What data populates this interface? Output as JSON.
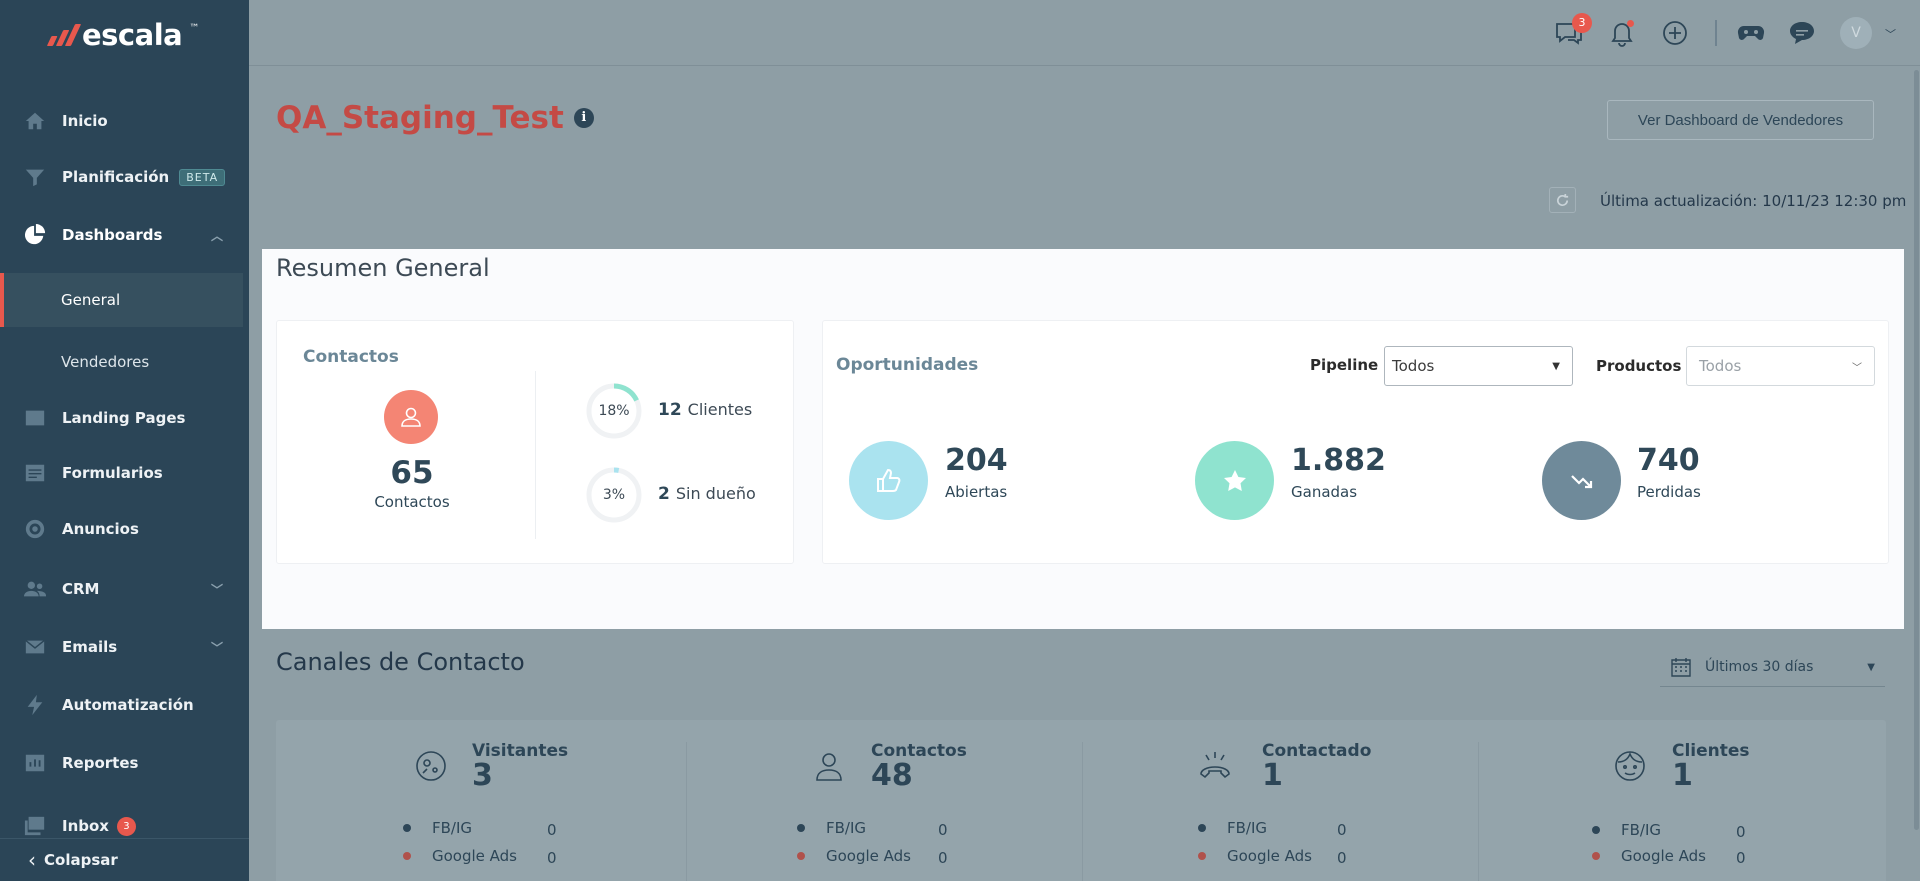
{
  "brand": {
    "name": "escala",
    "tm": "™"
  },
  "sidebar": {
    "items": [
      {
        "label": "Inicio",
        "icon": "home-icon"
      },
      {
        "label": "Planificación",
        "icon": "funnel-icon",
        "badge": "BETA"
      },
      {
        "label": "Dashboards",
        "icon": "pie-chart-icon"
      },
      {
        "label": "Landing Pages",
        "icon": "browser-icon"
      },
      {
        "label": "Formularios",
        "icon": "form-icon"
      },
      {
        "label": "Anuncios",
        "icon": "target-icon"
      },
      {
        "label": "CRM",
        "icon": "users-icon"
      },
      {
        "label": "Emails",
        "icon": "mail-icon"
      },
      {
        "label": "Automatización",
        "icon": "lightning-icon"
      },
      {
        "label": "Reportes",
        "icon": "report-icon"
      },
      {
        "label": "Inbox",
        "icon": "inbox-icon",
        "badge": "3"
      }
    ],
    "subitems": [
      {
        "label": "General"
      },
      {
        "label": "Vendedores"
      }
    ],
    "collapse_label": "Colapsar"
  },
  "topbar": {
    "chat_badge": "3",
    "avatar_initial": "V"
  },
  "page": {
    "title": "QA_Staging_Test",
    "info": "i",
    "sellers_button": "Ver Dashboard de Vendedores",
    "last_update": "Última actualización: 10/11/23 12:30 pm"
  },
  "summary": {
    "title": "Resumen General",
    "contacts": {
      "label": "Contactos",
      "total": "65",
      "total_label": "Contactos",
      "stats": [
        {
          "pct": "18%",
          "fraction": 0.18,
          "count": "12",
          "label": "Clientes"
        },
        {
          "pct": "3%",
          "fraction": 0.03,
          "count": "2",
          "label": "Sin dueño"
        }
      ]
    },
    "opportunities": {
      "label": "Oportunidades",
      "pipeline_label": "Pipeline",
      "pipeline_value": "Todos",
      "products_label": "Productos",
      "products_value": "Todos",
      "stats": [
        {
          "value": "204",
          "label": "Abiertas",
          "icon": "thumbs-up-icon",
          "color": "#aae3ef"
        },
        {
          "value": "1.882",
          "label": "Ganadas",
          "icon": "star-icon",
          "color": "#8fe3cf"
        },
        {
          "value": "740",
          "label": "Perdidas",
          "icon": "trend-down-icon",
          "color": "#6f8a9a"
        }
      ]
    }
  },
  "channels": {
    "title": "Canales de Contacto",
    "date_filter": "Últimos 30 días",
    "items": [
      {
        "title": "Visitantes",
        "count": "3",
        "icon": "visitor-icon",
        "rows": [
          {
            "label": "FB/IG",
            "value": "0",
            "color": "#2d4657"
          },
          {
            "label": "Google Ads",
            "value": "0",
            "color": "#b0514b"
          }
        ]
      },
      {
        "title": "Contactos",
        "count": "48",
        "icon": "person-icon",
        "rows": [
          {
            "label": "FB/IG",
            "value": "0",
            "color": "#2d4657"
          },
          {
            "label": "Google Ads",
            "value": "0",
            "color": "#b0514b"
          }
        ]
      },
      {
        "title": "Contactado",
        "count": "1",
        "icon": "phone-icon",
        "rows": [
          {
            "label": "FB/IG",
            "value": "0",
            "color": "#2d4657"
          },
          {
            "label": "Google Ads",
            "value": "0",
            "color": "#b0514b"
          }
        ]
      },
      {
        "title": "Clientes",
        "count": "1",
        "icon": "face-icon",
        "rows": [
          {
            "label": "FB/IG",
            "value": "0",
            "color": "#2d4657"
          },
          {
            "label": "Google Ads",
            "value": "0",
            "color": "#b0514b"
          }
        ]
      }
    ]
  }
}
